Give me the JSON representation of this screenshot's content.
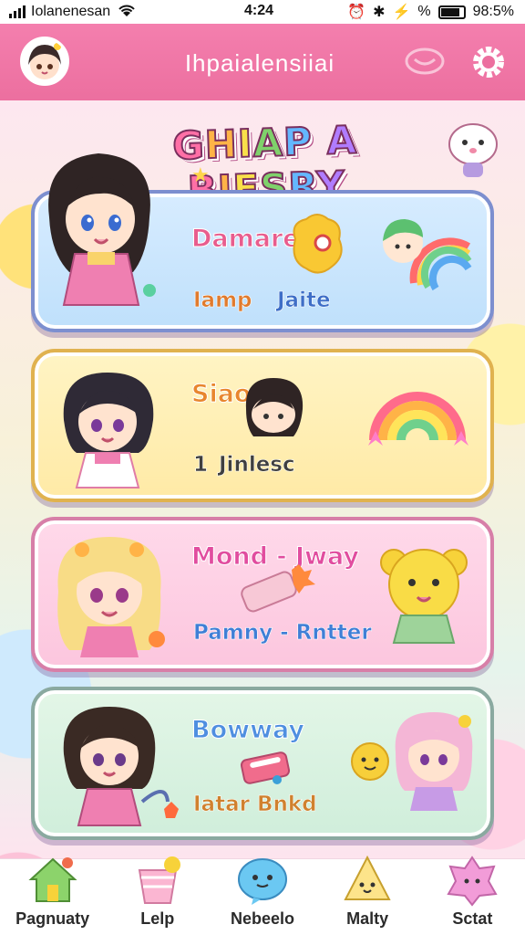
{
  "status_bar": {
    "carrier": "Iolanenesan",
    "time": "4:24",
    "battery_text": "98:5%"
  },
  "header": {
    "title": "Ihpaialensiiai"
  },
  "banner": {
    "letters": [
      "G",
      "H",
      "I",
      "A",
      "P",
      " ",
      "A",
      " ",
      "B",
      "I",
      "E",
      "S",
      "R",
      "Y"
    ]
  },
  "cards": [
    {
      "title": "Damare",
      "title_color": "#e85d8e",
      "sub_left": "Iamp",
      "sub_right": "Jaite",
      "sub_left_color": "#e07b2e",
      "sub_right_color": "#3e6ec7"
    },
    {
      "title": "Siaoei",
      "title_color": "#e8862e",
      "sub_left": "1",
      "sub_right": "Jinlesc",
      "sub_left_color": "#3f3f3f",
      "sub_right_color": "#3f3f3f"
    },
    {
      "title": "Mond - Jway",
      "title_color": "#e14d9f",
      "sub_left": "Pamny - Rntter",
      "sub_right": "",
      "sub_left_color": "#3f7fd6",
      "sub_right_color": "#3f7fd6"
    },
    {
      "title": "Bowway",
      "title_color": "#4f8fe0",
      "sub_left": "Iatar Bnkd",
      "sub_right": "",
      "sub_left_color": "#d0812e",
      "sub_right_color": "#d0812e"
    }
  ],
  "nav": [
    {
      "label": "Pagnuaty",
      "icon": "house-icon"
    },
    {
      "label": "Lelp",
      "icon": "cup-icon"
    },
    {
      "label": "Nebeelo",
      "icon": "bubble-icon"
    },
    {
      "label": "Malty",
      "icon": "pyramid-icon"
    },
    {
      "label": "Sctat",
      "icon": "star-blob-icon"
    }
  ],
  "colors": {
    "header_pink": "#ec6f9f",
    "nav_bg": "#ffffff"
  }
}
